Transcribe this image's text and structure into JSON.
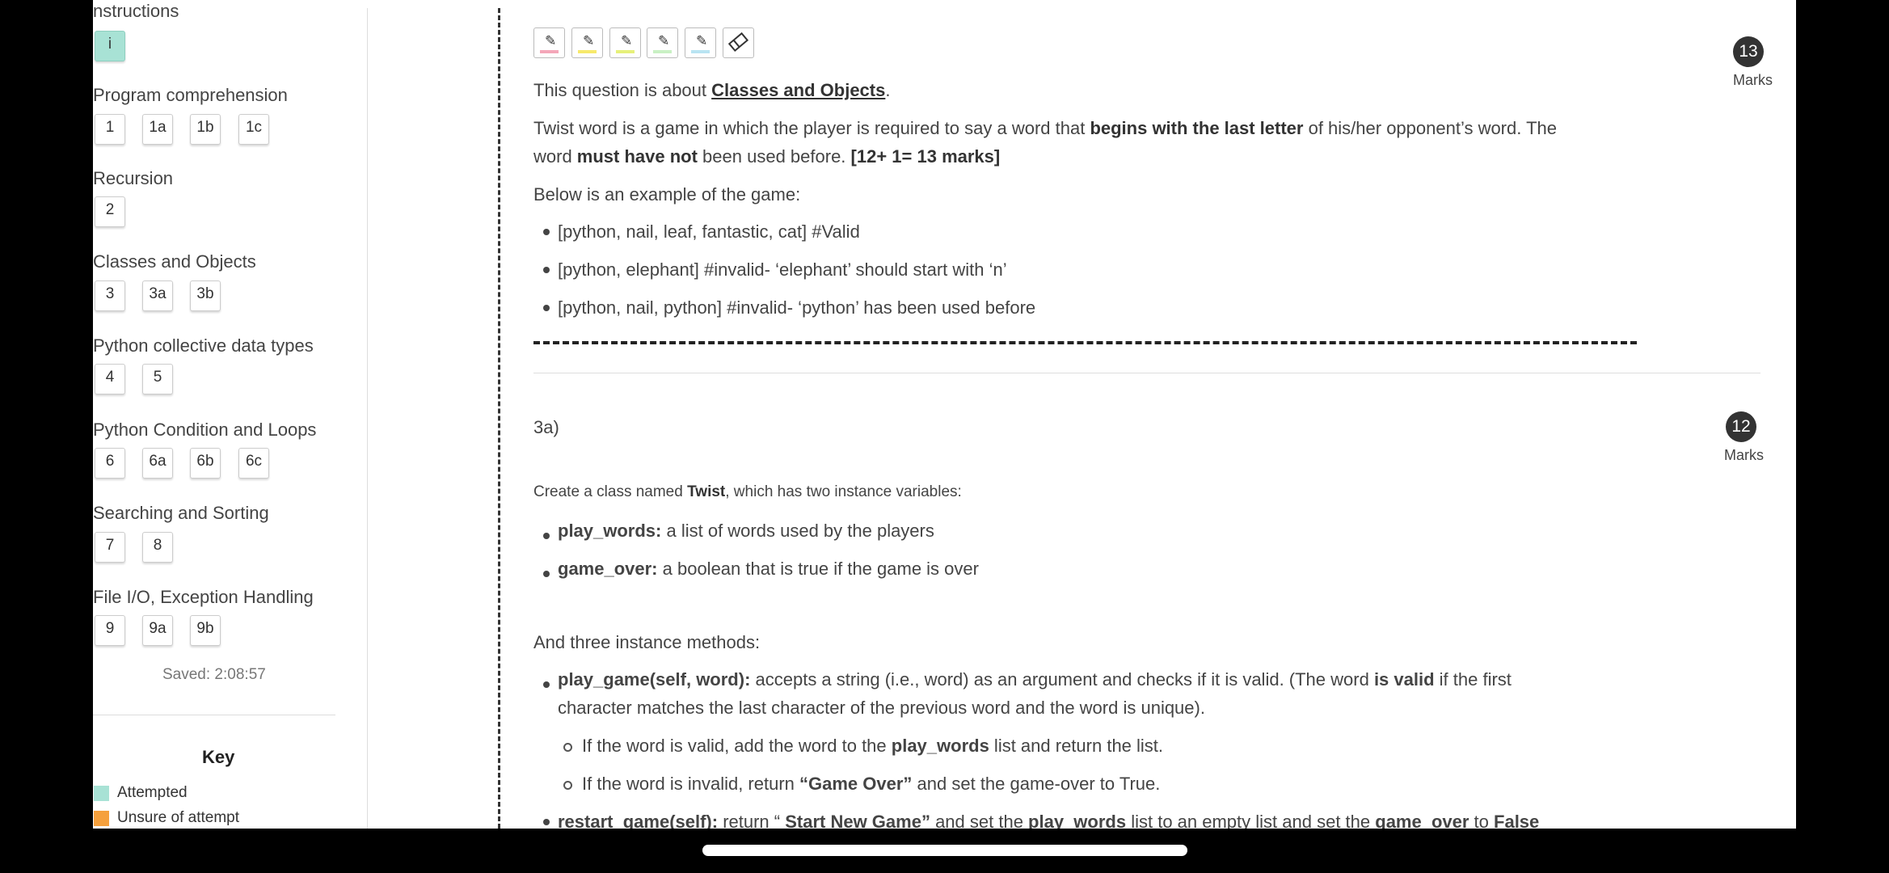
{
  "sidebar": {
    "sections": [
      {
        "title": "nstructions",
        "buttons": [
          {
            "label": "i",
            "attempted": true
          }
        ]
      },
      {
        "title": "Program comprehension",
        "buttons": [
          {
            "label": "1"
          },
          {
            "label": "1a"
          },
          {
            "label": "1b"
          },
          {
            "label": "1c"
          }
        ]
      },
      {
        "title": "Recursion",
        "buttons": [
          {
            "label": "2"
          }
        ]
      },
      {
        "title": "Classes and Objects",
        "buttons": [
          {
            "label": "3"
          },
          {
            "label": "3a"
          },
          {
            "label": "3b"
          }
        ]
      },
      {
        "title": "Python collective data types",
        "buttons": [
          {
            "label": "4"
          },
          {
            "label": "5"
          }
        ]
      },
      {
        "title": "Python Condition and Loops",
        "buttons": [
          {
            "label": "6"
          },
          {
            "label": "6a"
          },
          {
            "label": "6b"
          },
          {
            "label": "6c"
          }
        ]
      },
      {
        "title": "Searching and Sorting",
        "buttons": [
          {
            "label": "7"
          },
          {
            "label": "8"
          }
        ]
      },
      {
        "title": "File I/O, Exception Handling",
        "buttons": [
          {
            "label": "9"
          },
          {
            "label": "9a"
          },
          {
            "label": "9b"
          }
        ]
      }
    ],
    "saved": "Saved: 2:08:57",
    "key": {
      "title": "Key",
      "items": [
        {
          "label": "Attempted",
          "color": "#a8e2d5"
        },
        {
          "label": "Unsure of attempt",
          "color": "#f5a03c"
        }
      ]
    }
  },
  "toolbar": {
    "tools": [
      {
        "icon": "highlighter-pink-icon",
        "color": "#f4a7b9"
      },
      {
        "icon": "highlighter-yellow-icon",
        "color": "#f7e96b"
      },
      {
        "icon": "highlighter-lime-icon",
        "color": "#e6f07a"
      },
      {
        "icon": "highlighter-green-icon",
        "color": "#c9f0c4"
      },
      {
        "icon": "highlighter-blue-icon",
        "color": "#b9e4f2"
      },
      {
        "icon": "eraser-icon",
        "color": ""
      }
    ]
  },
  "question3": {
    "marks": "13",
    "marks_label": "Marks",
    "intro_prefix": "This question is about ",
    "intro_topic": "Classes and Objects",
    "intro_suffix": ".",
    "p1_a": "Twist word is a game in which the player is required to say a word that ",
    "p1_b": "begins with the last letter",
    "p1_c": " of his/her opponent’s word. The",
    "p1_d": "word ",
    "p1_e": "must have not",
    "p1_f": " been used before. ",
    "p1_g": "[12+ 1= 13 marks]",
    "example_intro": "Below is an example of the game:",
    "examples": [
      "[python, nail, leaf, fantastic, cat] #Valid",
      "[python, elephant] #invalid- ‘elephant’ should start with ‘n’",
      "[python, nail, python] #invalid- ‘python’ has been used before"
    ]
  },
  "question3a": {
    "label": "3a)",
    "marks": "12",
    "marks_label": "Marks",
    "p1_a": "Create a class named ",
    "p1_b": "Twist",
    "p1_c": ", which has two instance variables:",
    "vars": [
      {
        "name": "play_words:",
        "desc": " a list of words used by the players"
      },
      {
        "name": "game_over:",
        "desc": " a boolean that is true if the game is over"
      }
    ],
    "methods_intro": "And three instance methods:",
    "m1_name": "play_game(self, word):",
    "m1_desc": " accepts a string (i.e., word) as an argument and checks if it is valid. (The word ",
    "m1_bold": "is valid",
    "m1_tail": " if the first",
    "m1_line2": "character matches the last character of the previous word and the word is unique).",
    "sub1_a": "If the word is valid, add the word to the ",
    "sub1_b": "play_words",
    "sub1_c": " list and return the list.",
    "sub2_a": "If the word is invalid, return ",
    "sub2_b": "“Game Over”",
    "sub2_c": " and set the game-over to True.",
    "m2_name": "restart_game(self):",
    "m2_a": " return “ ",
    "m2_b": "Start New Game”",
    "m2_c": " and set the ",
    "m2_d": "play_words",
    "m2_e": " list to an empty list and set the ",
    "m2_f": "game_over",
    "m2_g": " to ",
    "m2_h": "False"
  },
  "embed_button": {
    "glyph": "<>"
  }
}
